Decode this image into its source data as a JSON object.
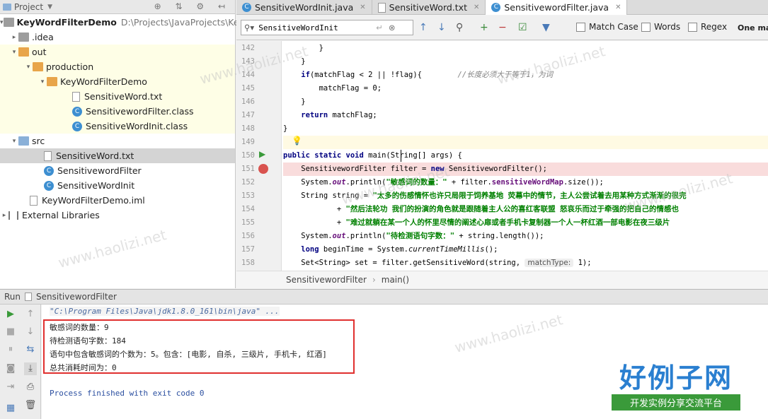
{
  "project_panel": {
    "title": "Project",
    "items": [
      {
        "label": "KeyWordFilterDemo",
        "extra": "D:\\Projects\\JavaProjects\\Ke",
        "type": "module"
      },
      {
        "label": ".idea",
        "type": "folder"
      },
      {
        "label": "out",
        "type": "folder-orange"
      },
      {
        "label": "production",
        "type": "folder-orange"
      },
      {
        "label": "KeyWordFilterDemo",
        "type": "folder-orange"
      },
      {
        "label": "SensitiveWord.txt",
        "type": "file"
      },
      {
        "label": "SensitivewordFilter.class",
        "type": "class"
      },
      {
        "label": "SensitiveWordInit.class",
        "type": "class"
      },
      {
        "label": "src",
        "type": "folder"
      },
      {
        "label": "SensitiveWord.txt",
        "type": "file"
      },
      {
        "label": "SensitivewordFilter",
        "type": "class"
      },
      {
        "label": "SensitiveWordInit",
        "type": "class"
      },
      {
        "label": "KeyWordFilterDemo.iml",
        "type": "file"
      },
      {
        "label": "External Libraries",
        "type": "lib"
      }
    ]
  },
  "tabs": [
    {
      "label": "SensitiveWordInit.java"
    },
    {
      "label": "SensitiveWord.txt"
    },
    {
      "label": "SensitivewordFilter.java"
    }
  ],
  "search": {
    "value": "SensitiveWordInit",
    "match_case": "Match Case",
    "words": "Words",
    "regex": "Regex",
    "one_match": "One ma"
  },
  "editor": {
    "line_numbers": [
      "142",
      "143",
      "144",
      "145",
      "146",
      "147",
      "148",
      "149",
      "150",
      "151",
      "152",
      "153",
      "154",
      "155",
      "156",
      "157",
      "158"
    ],
    "lines": {
      "l142": "        }",
      "l143": "    }",
      "l144a": "    if",
      "l144b": "(matchFlag < 2 || !flag){",
      "l144c": "        //长度必须大于等于1，为词",
      "l145": "        matchFlag = 0;",
      "l146": "    }",
      "l147a": "    return",
      "l147b": " matchFlag;",
      "l148": "}",
      "l149": "",
      "l150a": "public static void",
      "l150b": " main(String[] args) {",
      "l151a": "    SensitivewordFilter filter = ",
      "l151b": "new",
      "l151c": " SensitivewordFilter();",
      "l152a": "    System.",
      "l152b": "out",
      "l152c": ".println(",
      "l152d": "\"敏感词的数量：\"",
      "l152e": " + filter.",
      "l152f": "sensitiveWordMap",
      "l152g": ".size());",
      "l153a": "    String string = ",
      "l153b": "\"太多的伤感情怀也许只局限于饲养基地 荧幕中的情节，主人公尝试着去用某种方式渐渐的很完",
      "l154a": "            + ",
      "l154b": "\"然后法轮功 我们的扮演的角色就是跟随着主人公的喜红客联盟 怒哀乐而过于牵强的把自己的情感也",
      "l155a": "            + ",
      "l155b": "\"难过就躺在某一个人的怀里尽情的阐述心扉或者手机卡复制器一个人一杯红酒一部电影在夜三级片 ",
      "l156a": "    System.",
      "l156b": "out",
      "l156c": ".println(",
      "l156d": "\"待检测语句字数：\"",
      "l156e": " + string.length());",
      "l157a": "    long",
      "l157b": " beginTime = System.",
      "l157c": "currentTimeMillis",
      "l157d": "();",
      "l158a": "    Set<String> set = filter.getSensitiveWord(string, ",
      "l158hint": "matchType:",
      "l158b": " 1);"
    }
  },
  "breadcrumbs": [
    "SensitivewordFilter",
    "main()"
  ],
  "run_panel": {
    "label": "Run",
    "config": "SensitivewordFilter"
  },
  "console": {
    "cmd": "\"C:\\Program Files\\Java\\jdk1.8.0_161\\bin\\java\" ...",
    "out1": "敏感词的数量：9",
    "out2": "待检测语句字数：184",
    "out3": "语句中包含敏感词的个数为：5。包含：[电影, 自杀, 三级片, 手机卡, 红酒]",
    "out4": "总共消耗时间为：0",
    "exit": "Process finished with exit code 0"
  },
  "watermark": {
    "big": "好例子网",
    "small": "开发实例分享交流平台",
    "url": "www.haolizi.net"
  }
}
